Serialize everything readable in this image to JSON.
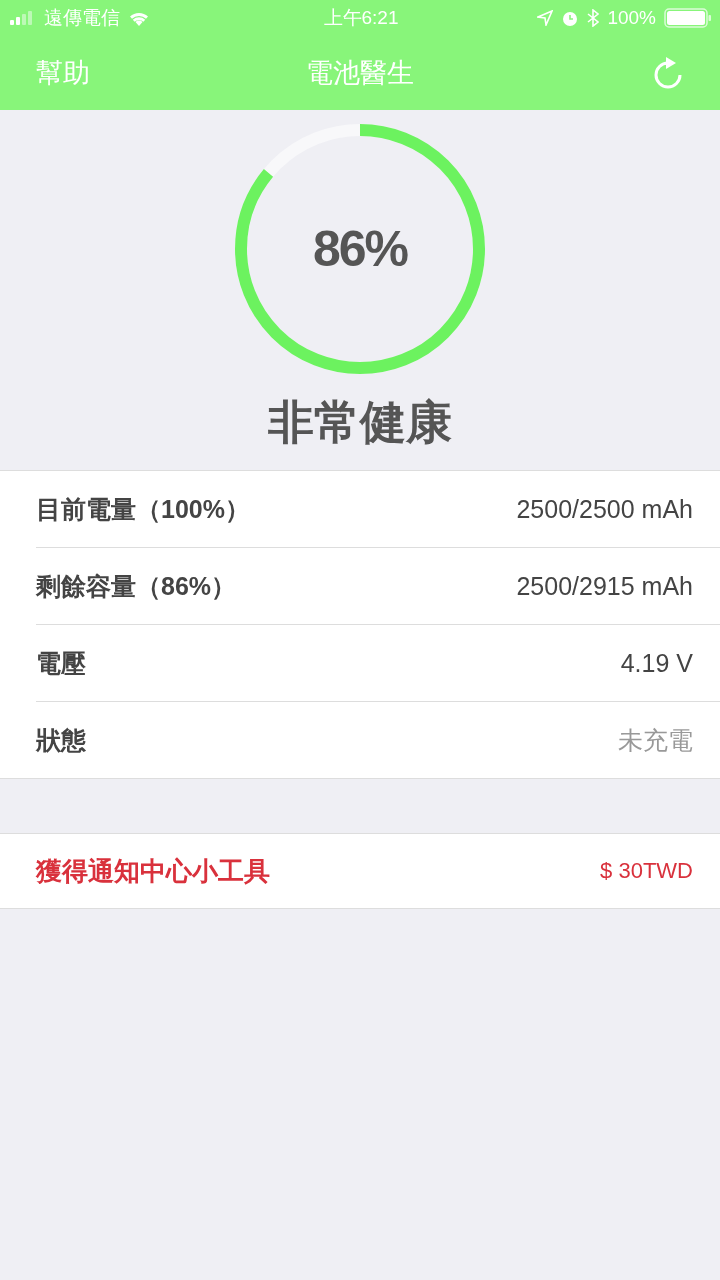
{
  "status_bar": {
    "carrier": "遠傳電信",
    "time": "上午6:21",
    "battery": "100%"
  },
  "nav": {
    "left": "幫助",
    "title": "電池醫生"
  },
  "health": {
    "percent": "86%",
    "verdict": "非常健康"
  },
  "rows": [
    {
      "label": "目前電量（100%）",
      "value": "2500/2500 mAh",
      "muted": false
    },
    {
      "label": "剩餘容量（86%）",
      "value": "2500/2915 mAh",
      "muted": false
    },
    {
      "label": "電壓",
      "value": "4.19 V",
      "muted": false
    },
    {
      "label": "狀態",
      "value": "未充電",
      "muted": true
    }
  ],
  "widget": {
    "label": "獲得通知中心小工具",
    "price": "$ 30TWD"
  }
}
